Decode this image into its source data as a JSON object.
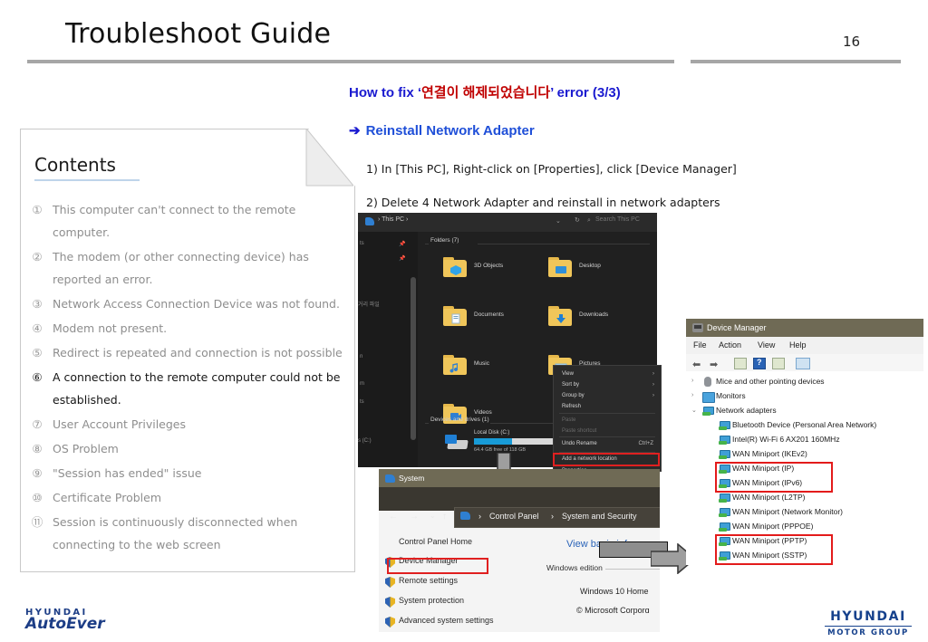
{
  "header": {
    "title": "Troubleshoot Guide",
    "page_number": "16"
  },
  "slide": {
    "subhead_prefix": "How to fix ‘",
    "subhead_korean": "연결이 해제되었습니다",
    "subhead_suffix": "’ error (3/3)",
    "arrow_glyph": "➔",
    "arrow_heading": "Reinstall Network Adapter",
    "step1": "1) In [This PC], Right-click on [Properties], click [Device Manager]",
    "step2": "2) Delete 4 Network Adapter and reinstall in network adapters"
  },
  "contents": {
    "title": "Contents",
    "items": [
      {
        "num": "①",
        "text": "This computer can't connect to the remote computer.",
        "highlight": false
      },
      {
        "num": "②",
        "text": "The modem (or other connecting device) has reported an error.",
        "highlight": false
      },
      {
        "num": "③",
        "text": "Network Access Connection Device was not found.",
        "highlight": false
      },
      {
        "num": "④",
        "text": "Modem not present.",
        "highlight": false
      },
      {
        "num": "⑤",
        "text": "Redirect is repeated and connection is not possible",
        "highlight": false
      },
      {
        "num": "⑥",
        "text": "A connection to the remote computer could not be established.",
        "highlight": true
      },
      {
        "num": "⑦",
        "text": "User Account Privileges",
        "highlight": false
      },
      {
        "num": "⑧",
        "text": "OS Problem",
        "highlight": false
      },
      {
        "num": "⑨",
        "text": "\"Session has ended\" issue",
        "highlight": false
      },
      {
        "num": "⑩",
        "text": "Certificate Problem",
        "highlight": false
      },
      {
        "num": "⑪",
        "text": "Session is continuously disconnected when connecting to the web screen",
        "highlight": false
      }
    ]
  },
  "explorer": {
    "breadcrumb": "›  This PC  ›",
    "chevron": "⌄",
    "refresh": "↻",
    "search_icon": "⌕",
    "search_placeholder": "Search This PC",
    "nav_items": [
      "ts",
      "╱",
      "거리 파일",
      "n",
      "m",
      "ts",
      "s (C:)"
    ],
    "group_folders": "Folders (7)",
    "group_drives": "Devices and drives (1)",
    "folders": [
      "3D Objects",
      "Desktop",
      "Documents",
      "Downloads",
      "Music",
      "Pictures",
      "Videos"
    ],
    "drive_name": "Local Disk (C:)",
    "drive_sub": "64.4 GB free of 118 GB",
    "context_menu": {
      "items": [
        {
          "label": "View",
          "accel": "",
          "caret": "›",
          "dim": false
        },
        {
          "label": "Sort by",
          "accel": "",
          "caret": "›",
          "dim": false
        },
        {
          "label": "Group by",
          "accel": "",
          "caret": "›",
          "dim": false
        },
        {
          "label": "Refresh",
          "accel": "",
          "caret": "",
          "dim": false
        },
        {
          "label": "Paste",
          "accel": "",
          "caret": "",
          "dim": true
        },
        {
          "label": "Paste shortcut",
          "accel": "",
          "caret": "",
          "dim": true
        },
        {
          "label": "Undo Rename",
          "accel": "Ctrl+Z",
          "caret": "",
          "dim": false
        },
        {
          "label": "Add a network location",
          "accel": "",
          "caret": "",
          "dim": false
        },
        {
          "label": "Properties",
          "accel": "",
          "caret": "",
          "dim": false
        }
      ]
    }
  },
  "system_window": {
    "title": "System",
    "nav_back": "←",
    "nav_forward": "→",
    "nav_recent": "⌄",
    "nav_up": "↑",
    "crumb_sep": "›",
    "crumb1": "Control Panel",
    "crumb2": "System and Security",
    "left_links": [
      "Control Panel Home",
      "Device Manager",
      "Remote settings",
      "System protection",
      "Advanced system settings"
    ],
    "main_heading": "View basic informa",
    "section_label": "Windows edition",
    "edition": "Windows 10 Home",
    "copyright": "© Microsoft Corporɑ"
  },
  "device_manager": {
    "title": "Device Manager",
    "menu": [
      "File",
      "Action",
      "View",
      "Help"
    ],
    "toolbar_icons": [
      "back-arrow",
      "forward-arrow",
      "properties-icon",
      "help-icon",
      "scan-icon",
      "monitor-icon"
    ],
    "help_glyph": "?",
    "tree": [
      {
        "label": "Mice and other pointing devices",
        "indent": 0,
        "caret": "›",
        "icon": "mouse",
        "boxed": false
      },
      {
        "label": "Monitors",
        "indent": 0,
        "caret": "›",
        "icon": "monitor",
        "boxed": false
      },
      {
        "label": "Network adapters",
        "indent": 0,
        "caret": "⌄",
        "icon": "nic",
        "boxed": false
      },
      {
        "label": "Bluetooth Device (Personal Area Network)",
        "indent": 1,
        "caret": "",
        "icon": "nic",
        "boxed": false
      },
      {
        "label": "Intel(R) Wi-Fi 6 AX201 160MHz",
        "indent": 1,
        "caret": "",
        "icon": "nic",
        "boxed": false
      },
      {
        "label": "WAN Miniport (IKEv2)",
        "indent": 1,
        "caret": "",
        "icon": "nic",
        "boxed": false
      },
      {
        "label": "WAN Miniport (IP)",
        "indent": 1,
        "caret": "",
        "icon": "nic",
        "boxed": true
      },
      {
        "label": "WAN Miniport (IPv6)",
        "indent": 1,
        "caret": "",
        "icon": "nic",
        "boxed": true
      },
      {
        "label": "WAN Miniport (L2TP)",
        "indent": 1,
        "caret": "",
        "icon": "nic",
        "boxed": false
      },
      {
        "label": "WAN Miniport (Network Monitor)",
        "indent": 1,
        "caret": "",
        "icon": "nic",
        "boxed": false
      },
      {
        "label": "WAN Miniport (PPPOE)",
        "indent": 1,
        "caret": "",
        "icon": "nic",
        "boxed": false
      },
      {
        "label": "WAN Miniport (PPTP)",
        "indent": 1,
        "caret": "",
        "icon": "nic",
        "boxed": true
      },
      {
        "label": "WAN Miniport (SSTP)",
        "indent": 1,
        "caret": "",
        "icon": "nic",
        "boxed": true
      }
    ]
  },
  "footer": {
    "autoever_top": "HYUNDAI",
    "autoever_bottom": "AutoEver",
    "hmg_top": "HYUNDAI",
    "hmg_bottom": "MOTOR GROUP"
  },
  "colors": {
    "accent_blue": "#1a1ad0",
    "korean_red": "#c00000",
    "highlight_red": "#e31b1b",
    "brand_navy": "#16418c",
    "rule_gray": "#a6a6a6"
  }
}
